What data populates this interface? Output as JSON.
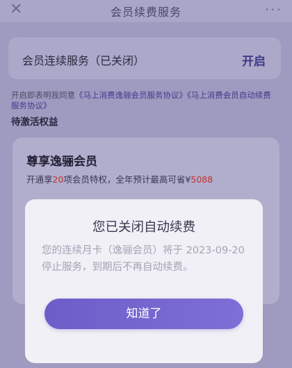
{
  "nav": {
    "close_glyph": "✕",
    "title": "会员续费服务",
    "more_glyph": "···"
  },
  "service": {
    "label": "会员连续服务（已关闭）",
    "action": "开启"
  },
  "agreement": {
    "prefix": "开启即表明我同意",
    "link1": "《马上消费逸骊会员服务协议》",
    "link2": "《马上消费会员自动续费服务协议》"
  },
  "pending": "待激活权益",
  "vip": {
    "title": "尊享逸骊会员",
    "desc_pre": "开通享",
    "count": "20",
    "desc_mid": "项会员特权，全年预计最高可省¥",
    "amount": "5088"
  },
  "dialog": {
    "title": "您已关闭自动续费",
    "body": "您的连续月卡（逸骊会员）将于 2023-09-20 停止服务，到期后不再自动续费。",
    "button": "知道了"
  },
  "colors": {
    "accent": "#6c5dc8",
    "highlight": "#c4312e",
    "overlay": "#9f9bc0"
  }
}
